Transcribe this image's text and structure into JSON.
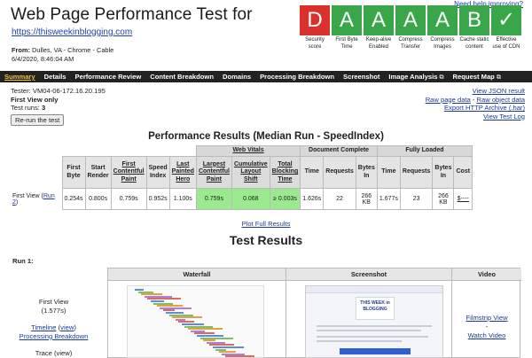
{
  "header": {
    "title": "Web Page Performance Test for",
    "url": "https://thisweekinblogging.com",
    "from_label": "From:",
    "from_value": "Dulles, VA - Chrome - Cable",
    "date": "6/4/2020, 8:46:04 AM",
    "help_link": "Need help improving?"
  },
  "grades": [
    {
      "grade": "D",
      "label": "Security score",
      "color": "#d9312b"
    },
    {
      "grade": "A",
      "label": "First Byte Time",
      "color": "#3aa64a"
    },
    {
      "grade": "A",
      "label": "Keep-alive Enabled",
      "color": "#3aa64a"
    },
    {
      "grade": "A",
      "label": "Compress Transfer",
      "color": "#3aa64a"
    },
    {
      "grade": "A",
      "label": "Compress Images",
      "color": "#3aa64a"
    },
    {
      "grade": "B",
      "label": "Cache static content",
      "color": "#3aa64a"
    },
    {
      "grade": "✓",
      "label": "Effective use of CDN",
      "color": "#3aa64a"
    }
  ],
  "nav": [
    {
      "label": "Summary",
      "active": true,
      "ext": ""
    },
    {
      "label": "Details",
      "active": false,
      "ext": ""
    },
    {
      "label": "Performance Review",
      "active": false,
      "ext": ""
    },
    {
      "label": "Content Breakdown",
      "active": false,
      "ext": ""
    },
    {
      "label": "Domains",
      "active": false,
      "ext": ""
    },
    {
      "label": "Processing Breakdown",
      "active": false,
      "ext": ""
    },
    {
      "label": "Screenshot",
      "active": false,
      "ext": ""
    },
    {
      "label": "Image Analysis",
      "active": false,
      "ext": "⧉"
    },
    {
      "label": "Request Map",
      "active": false,
      "ext": "⧉"
    }
  ],
  "tester": {
    "tester": "Tester: VM04-06-172.16.20.195",
    "view": "First View only",
    "runs_label": "Test runs:",
    "runs_value": "3",
    "rerun": "Re-run the test"
  },
  "right_links": {
    "json": "View JSON result",
    "raw_page": "Raw page data",
    "sep": " - ",
    "raw_object": "Raw object data",
    "har": "Export HTTP Archive (.har)",
    "log": "View Test Log"
  },
  "performance": {
    "title": "Performance Results (Median Run - SpeedIndex)",
    "groups": {
      "web_vitals": "Web Vitals",
      "document_complete": "Document Complete",
      "fully_loaded": "Fully Loaded"
    },
    "headers": [
      "First Byte",
      "Start Render",
      "First Contentful Paint",
      "Speed Index",
      "Last Painted Hero",
      "Largest Contentful Paint",
      "Cumulative Layout Shift",
      "Total Blocking Time",
      "Time",
      "Requests",
      "Bytes In",
      "Time",
      "Requests",
      "Bytes In",
      "Cost"
    ],
    "row_label": "First View (",
    "row_link": "Run 2",
    "row_close": ")",
    "values": [
      "0.254s",
      "0.800s",
      "0.759s",
      "0.952s",
      "1.100s",
      "0.759s",
      "0.068",
      "≥ 0.003s",
      "1.626s",
      "22",
      "266 KB",
      "1.677s",
      "23",
      "266 KB",
      "$----"
    ],
    "plot_link": "Plot Full Results"
  },
  "test_results": {
    "title": "Test Results",
    "run_label": "Run 1:",
    "columns": [
      "Waterfall",
      "Screenshot",
      "Video"
    ],
    "first_view": "First View",
    "first_view_time": "(1.577s)",
    "timeline": "Timeline",
    "view_link": "view",
    "processing": "Processing Breakdown",
    "trace": "Trace (view)",
    "filmstrip": "Filmstrip View",
    "dash": "-",
    "watch": "Watch Video",
    "shot_logo": "THIS WEEK in BLOGGING"
  }
}
